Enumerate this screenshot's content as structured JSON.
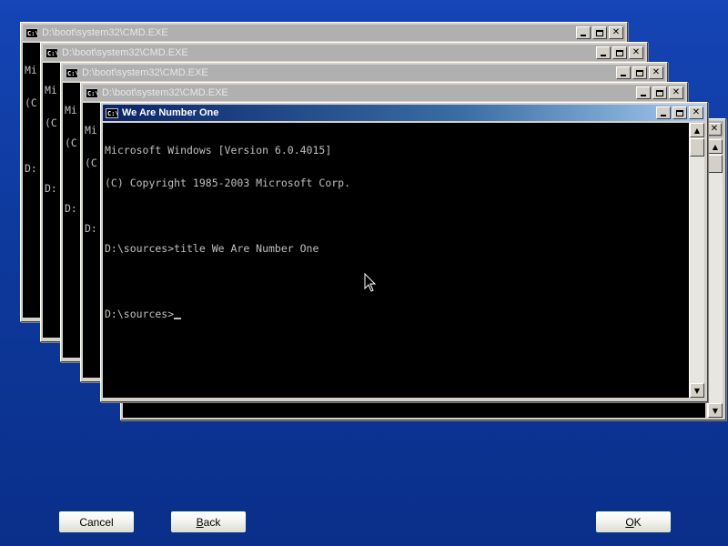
{
  "back_windows": [
    {
      "title": "D:\\boot\\system32\\CMD.EXE",
      "lines": [
        "Mi",
        "(C",
        "",
        "D:"
      ]
    },
    {
      "title": "D:\\boot\\system32\\CMD.EXE",
      "lines": [
        "Mi",
        "(C",
        "",
        "D:"
      ]
    },
    {
      "title": "D:\\boot\\system32\\CMD.EXE",
      "lines": [
        "Mi",
        "(C",
        "",
        "D:"
      ]
    },
    {
      "title": "D:\\boot\\system32\\CMD.EXE",
      "lines": [
        "Mi",
        "(C",
        "",
        "D:"
      ]
    }
  ],
  "rear_right_window": {
    "title": ""
  },
  "active_window": {
    "title": "We Are Number One",
    "lines": [
      "Microsoft Windows [Version 6.0.4015]",
      "(C) Copyright 1985-2003 Microsoft Corp.",
      "",
      "D:\\sources>title We Are Number One",
      "",
      "D:\\sources>"
    ]
  },
  "title_buttons": {
    "minimize": "_",
    "maximize": "□",
    "close": "✕"
  },
  "scroll_icons": {
    "up": "▲",
    "down": "▼"
  },
  "icons": {
    "window_icon": "C:\\",
    "mouse": "arrow-cursor-icon"
  },
  "buttons": {
    "cancel": "Cancel",
    "back_first": "B",
    "back_rest": "ack",
    "ok_first": "O",
    "ok_rest": "K"
  },
  "colors": {
    "desktop": "#0e3a9e",
    "console_bg": "#000000",
    "console_fg": "#c0c0c0",
    "active_title": "#0a246a"
  }
}
